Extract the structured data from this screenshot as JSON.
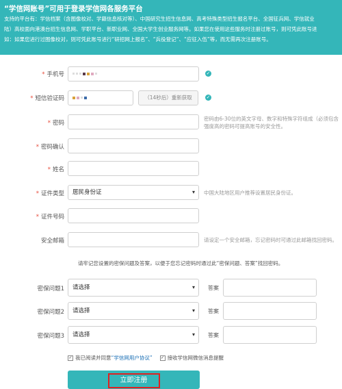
{
  "banner": {
    "title": "“学信网账号”可用于登录学信网各服务平台",
    "lines": [
      "支持的平台有：学信档案（含图像校对、学籍信息核对等）、中国研究生招生信息网、高考特殊类型招生报名平台、全国征兵网、学信就业",
      "陆）高校面向港澳台招生信息网、学职平台、新职业网、全国大学生创业服务网等。如果您在使用这些服务时注册过账号，则可凭此账号进",
      "如：如果您进行过图像校对，则可凭此账号进行“研招网上报名”、“兵役登记”、“应征入伍”等，而无需再次注册账号。"
    ]
  },
  "form": {
    "phone": {
      "label": "手机号"
    },
    "sms": {
      "label": "短信验证码",
      "resend": "（14秒后）重新获取"
    },
    "password": {
      "label": "密码",
      "hint": [
        "密码由6-30位的英文字母、数字和特殊字符组成（必须包含",
        "强度高的密码可提高账号的安全性。"
      ]
    },
    "confirm": {
      "label": "密码确认"
    },
    "name": {
      "label": "姓名"
    },
    "idtype": {
      "label": "证件类型",
      "value": "居民身份证",
      "hint": "中国大陆地区用户推荐设置居民身份证。"
    },
    "idnum": {
      "label": "证件号码"
    },
    "email": {
      "label": "安全邮箱",
      "hint": "请设定一个安全邮箱，忘记密码时可通过此邮箱找回密码。"
    },
    "note": "请牢记您设置的密保问题及答案，以便于您忘记密码时通过此“密保问题、答案”找回密码。",
    "questions": [
      {
        "label": "密保问题1",
        "value": "请选择",
        "answer": "答案"
      },
      {
        "label": "密保问题2",
        "value": "请选择",
        "answer": "答案"
      },
      {
        "label": "密保问题3",
        "value": "请选择",
        "answer": "答案"
      }
    ],
    "agree1": {
      "prefix": "我已阅读并同意",
      "link": "“学信网用户协议”"
    },
    "agree2": "接收学信网微信消息提醒",
    "submit": "立即注册"
  },
  "colors": {
    "accent": "#34b6b9",
    "required": "#e74c3c",
    "highlight": "#e02020"
  }
}
